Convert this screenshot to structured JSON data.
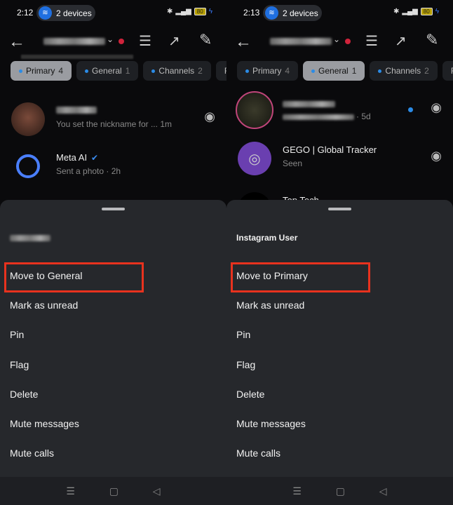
{
  "panels": [
    {
      "time": "2:12",
      "devices": "2 devices",
      "battery": "80",
      "tabs": [
        {
          "label": "Primary",
          "count": "4"
        },
        {
          "label": "General",
          "count": "1"
        },
        {
          "label": "Channels",
          "count": "2"
        },
        {
          "label": "Re",
          "count": ""
        }
      ],
      "chats": [
        {
          "subtitle": "You set the nickname for ...",
          "time": "1m"
        },
        {
          "name": "Meta AI",
          "subtitle": "Sent a photo · 2h"
        }
      ],
      "sheet_title": "",
      "menu": [
        "Move to General",
        "Mark as unread",
        "Pin",
        "Flag",
        "Delete",
        "Mute messages",
        "Mute calls"
      ]
    },
    {
      "time": "2:13",
      "devices": "2 devices",
      "battery": "80",
      "tabs": [
        {
          "label": "Primary",
          "count": "4"
        },
        {
          "label": "General",
          "count": "1"
        },
        {
          "label": "Channels",
          "count": "2"
        },
        {
          "label": "Re",
          "count": ""
        }
      ],
      "chats": [
        {
          "subtitle": "· 5d"
        },
        {
          "name": "GEGO | Global Tracker",
          "subtitle": "Seen"
        },
        {
          "name": "Top Tech"
        }
      ],
      "sheet_title": "Instagram User",
      "menu": [
        "Move to Primary",
        "Mark as unread",
        "Pin",
        "Flag",
        "Delete",
        "Mute messages",
        "Mute calls"
      ]
    }
  ],
  "colors": {
    "highlight": "#e8321e",
    "accent": "#2b8be6",
    "sheet": "#26282c"
  },
  "icons": {
    "back": "arrow-left",
    "list": "list",
    "trend": "trending-up",
    "edit": "compose",
    "camera": "camera",
    "devices": "wifi-router"
  }
}
